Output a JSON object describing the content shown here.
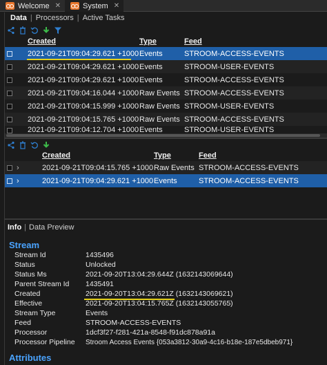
{
  "tabs": [
    {
      "label": "Welcome",
      "close": "✕"
    },
    {
      "label": "System",
      "close": "✕"
    }
  ],
  "subtabs": {
    "data": "Data",
    "sep1": "|",
    "processors": "Processors",
    "sep2": "|",
    "active_tasks": "Active Tasks"
  },
  "top_grid": {
    "headers": {
      "created": "Created",
      "type": "Type",
      "feed": "Feed"
    },
    "rows": [
      {
        "created": "2021-09-21T09:04:29.621 +1000",
        "type": "Events",
        "feed": "STROOM-ACCESS-EVENTS"
      },
      {
        "created": "2021-09-21T09:04:29.621 +1000",
        "type": "Events",
        "feed": "STROOM-USER-EVENTS"
      },
      {
        "created": "2021-09-21T09:04:29.621 +1000",
        "type": "Events",
        "feed": "STROOM-ACCESS-EVENTS"
      },
      {
        "created": "2021-09-21T09:04:16.044 +1000",
        "type": "Raw Events",
        "feed": "STROOM-ACCESS-EVENTS"
      },
      {
        "created": "2021-09-21T09:04:15.999 +1000",
        "type": "Raw Events",
        "feed": "STROOM-USER-EVENTS"
      },
      {
        "created": "2021-09-21T09:04:15.765 +1000",
        "type": "Raw Events",
        "feed": "STROOM-ACCESS-EVENTS"
      },
      {
        "created": "2021-09-21T09:04:12.704 +1000",
        "type": "Events",
        "feed": "STROOM-USER-EVENTS"
      }
    ]
  },
  "bottom_grid": {
    "headers": {
      "created": "Created",
      "type": "Type",
      "feed": "Feed"
    },
    "rows": [
      {
        "expander": "›",
        "created": "2021-09-21T09:04:15.765 +1000",
        "type": "Raw Events",
        "feed": "STROOM-ACCESS-EVENTS"
      },
      {
        "expander": "›",
        "created": "2021-09-21T09:04:29.621 +1000",
        "type": "Events",
        "feed": "STROOM-ACCESS-EVENTS"
      }
    ]
  },
  "info_tabs": {
    "info": "Info",
    "sep": "|",
    "preview": "Data Preview"
  },
  "stream": {
    "title": "Stream",
    "props": [
      {
        "k": "Stream Id",
        "v": "1435496"
      },
      {
        "k": "Status",
        "v": "Unlocked"
      },
      {
        "k": "Status Ms",
        "v": "2021-09-20T13:04:29.644Z (1632143069644)"
      },
      {
        "k": "Parent Stream Id",
        "v": "1435491"
      },
      {
        "k": "Created",
        "v": "2021-09-20T13:04:29.621Z (1632143069621)"
      },
      {
        "k": "Effective",
        "v": "2021-09-20T13:04:15.765Z (1632143055765)"
      },
      {
        "k": "Stream Type",
        "v": "Events"
      },
      {
        "k": "Feed",
        "v": "STROOM-ACCESS-EVENTS"
      },
      {
        "k": "Processor",
        "v": "1dcf3f27-f281-421a-8548-f91dc878a91a"
      },
      {
        "k": "Processor Pipeline",
        "v": "Stroom Access Events {053a3812-30a9-4c16-b18e-187e5dbeb971}"
      }
    ]
  },
  "attributes": {
    "title": "Attributes"
  },
  "colors": {
    "accent_blue": "#4aa3ff",
    "selection": "#1f5fa8",
    "highlight": "#e6d21c",
    "logo": "#e8752b",
    "icon_green": "#3dbb4a"
  }
}
